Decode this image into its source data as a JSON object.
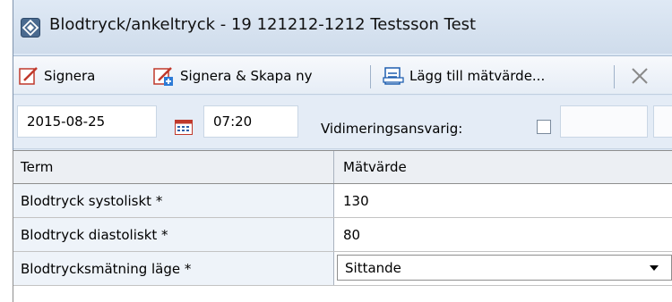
{
  "window": {
    "title": "Blodtryck/ankeltryck -  19 121212-1212 Testsson Test",
    "icon": "diamond-app-icon"
  },
  "toolbar": {
    "sign_label": "Signera",
    "sign_create_label": "Signera & Skapa ny",
    "add_value_label": "Lägg till mätvärde...",
    "close_icon": "close-icon"
  },
  "form": {
    "date_value": "2015-08-25",
    "time_value": "07:20",
    "verifier_label": "Vidimeringsansvarig:",
    "verifier_checked": false
  },
  "grid": {
    "columns": [
      "Term",
      "Mätvärde"
    ],
    "rows": [
      {
        "term": "Blodtryck systoliskt *",
        "value": "130"
      },
      {
        "term": "Blodtryck diastoliskt *",
        "value": "80"
      },
      {
        "term": "Blodtrycksmätning läge *",
        "value": "Sittande"
      }
    ]
  }
}
